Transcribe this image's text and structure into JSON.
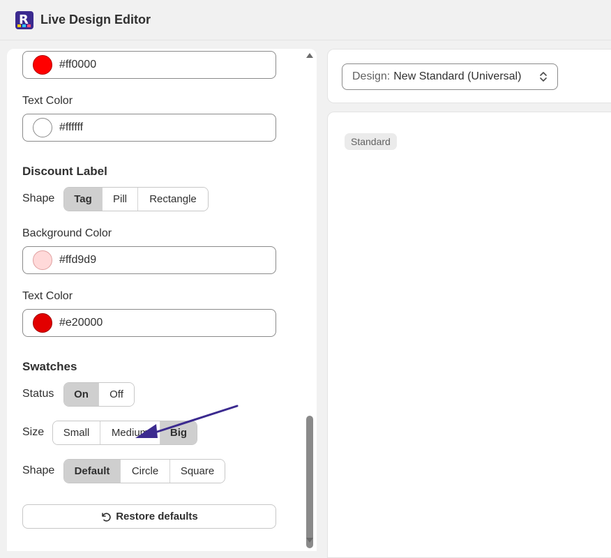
{
  "app": {
    "title": "Live Design Editor"
  },
  "left": {
    "sale_bg": {
      "value": "#ff0000",
      "color": "#ff0000"
    },
    "sale_text": {
      "label": "Text Color",
      "value": "#ffffff",
      "color": "#ffffff"
    },
    "discount": {
      "heading": "Discount Label",
      "shape_label": "Shape",
      "shapes": [
        "Tag",
        "Pill",
        "Rectangle"
      ],
      "shape_selected": "Tag",
      "bg": {
        "label": "Background Color",
        "value": "#ffd9d9",
        "color": "#ffd9d9"
      },
      "text": {
        "label": "Text Color",
        "value": "#e20000",
        "color": "#e20000"
      }
    },
    "swatches": {
      "heading": "Swatches",
      "status_label": "Status",
      "status_options": [
        "On",
        "Off"
      ],
      "status_selected": "On",
      "size_label": "Size",
      "size_options": [
        "Small",
        "Medium",
        "Big"
      ],
      "size_selected": "Big",
      "shape_label": "Shape",
      "shape_options": [
        "Default",
        "Circle",
        "Square"
      ],
      "shape_selected": "Default"
    },
    "restore_label": "Restore defaults"
  },
  "right": {
    "design_prefix": "Design:",
    "design_value": "New Standard (Universal)",
    "badge": "Standard"
  },
  "colors": {
    "annotation_arrow": "#3b2a8f"
  }
}
